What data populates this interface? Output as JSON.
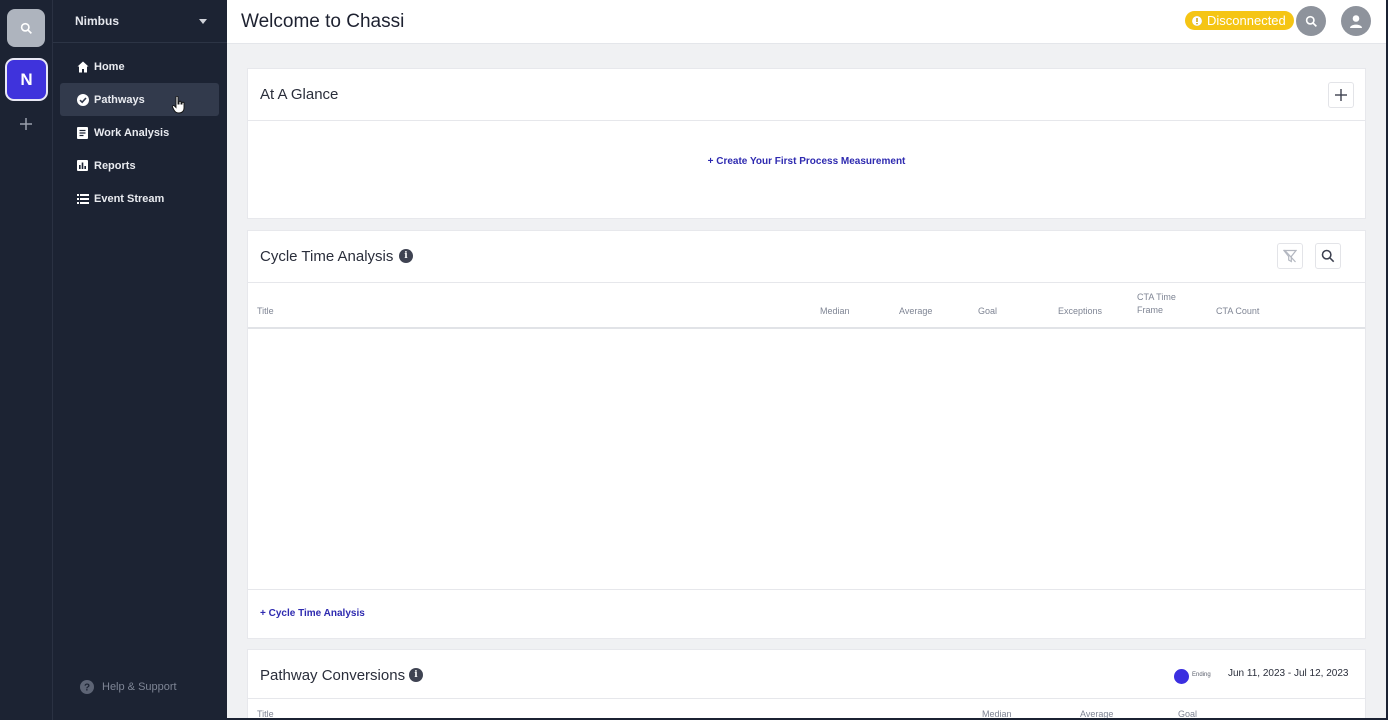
{
  "rail": {
    "org_initial": "N"
  },
  "nav": {
    "org_name": "Nimbus",
    "items": [
      {
        "label": "Home",
        "icon": "home-icon"
      },
      {
        "label": "Pathways",
        "icon": "check-circle-icon"
      },
      {
        "label": "Work Analysis",
        "icon": "document-icon"
      },
      {
        "label": "Reports",
        "icon": "bar-chart-icon"
      },
      {
        "label": "Event Stream",
        "icon": "list-icon"
      }
    ],
    "help_label": "Help & Support"
  },
  "header": {
    "title": "Welcome to Chassi",
    "status_badge": "Disconnected",
    "status_color": "#f5c514"
  },
  "at_a_glance": {
    "title": "At A Glance",
    "create_link": "+ Create Your First Process Measurement"
  },
  "cycle_time": {
    "title": "Cycle Time Analysis",
    "columns": {
      "title": "Title",
      "median": "Median",
      "average": "Average",
      "goal": "Goal",
      "exceptions": "Exceptions",
      "cta_time_frame_1": "CTA Time",
      "cta_time_frame_2": "Frame",
      "cta_count": "CTA Count"
    },
    "add_link": "+ Cycle Time Analysis"
  },
  "pathway_conversions": {
    "title": "Pathway Conversions",
    "legend_label": "Ending",
    "legend_color": "#3b2fe0",
    "date_range": "Jun 11, 2023 - Jul 12, 2023",
    "columns": {
      "title": "Title",
      "median": "Median",
      "average": "Average",
      "goal": "Goal"
    }
  },
  "colors": {
    "accent": "#3f33dc",
    "link": "#2e2ab0",
    "sidebar_bg": "#1c2333"
  }
}
